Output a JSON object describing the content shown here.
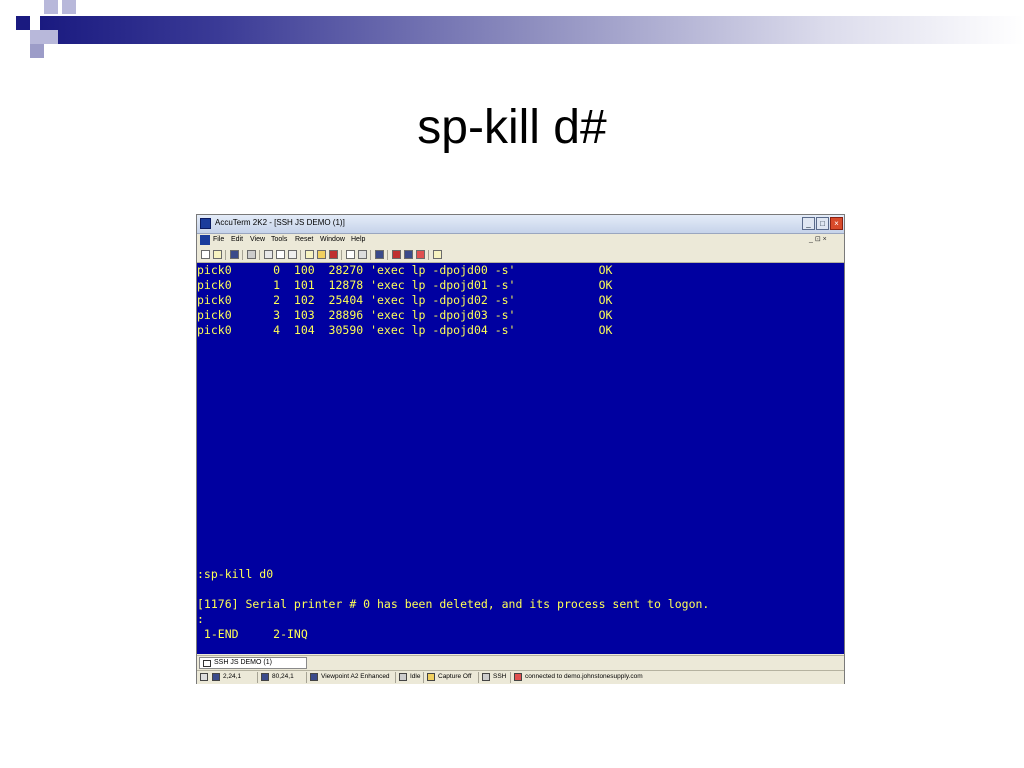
{
  "slide": {
    "title": "sp-kill d#"
  },
  "window": {
    "title": "AccuTerm 2K2 - [SSH JS DEMO (1)]",
    "menu": [
      "File",
      "Edit",
      "View",
      "Tools",
      "Reset",
      "Window",
      "Help"
    ],
    "mdi_controls": "_ ⊡ ×"
  },
  "terminal": {
    "lines": [
      "pick0      0  100  28270 'exec lp -dpojd00 -s'            OK",
      "pick0      1  101  12878 'exec lp -dpojd01 -s'            OK",
      "pick0      2  102  25404 'exec lp -dpojd02 -s'            OK",
      "pick0      3  103  28896 'exec lp -dpojd03 -s'            OK",
      "pick0      4  104  30590 'exec lp -dpojd04 -s'            OK",
      ":sp-kill d0",
      "[1176] Serial printer # 0 has been deleted, and its process sent to logon.",
      ":",
      " 1-END     2-INQ"
    ]
  },
  "tab": {
    "label": "SSH JS DEMO (1)"
  },
  "status": {
    "cursor": "2,24,1",
    "size": "80,24,1",
    "emulation": "Viewpoint A2 Enhanced",
    "printer": "Idle",
    "capture": "Capture Off",
    "protocol": "SSH",
    "connection": "connected to demo.johnstonesupply.com"
  }
}
